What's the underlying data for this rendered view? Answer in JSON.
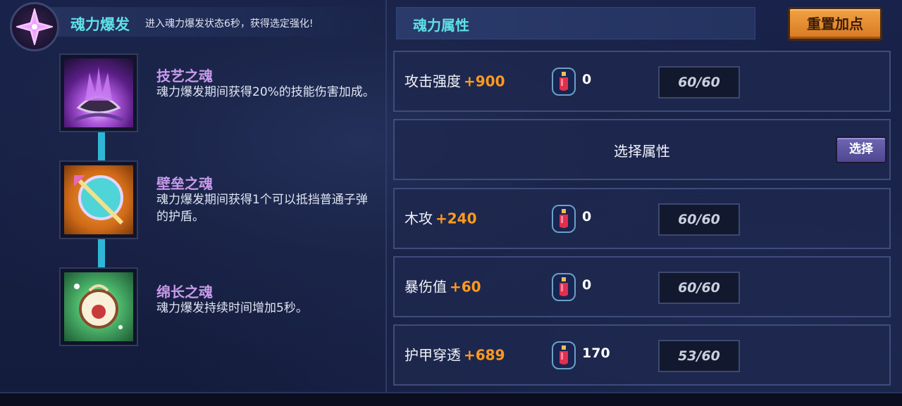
{
  "header": {
    "title": "魂力爆发",
    "description": "进入魂力爆发状态6秒，获得选定强化!",
    "icon": "soul-burst-icon"
  },
  "souls": [
    {
      "name": "技艺之魂",
      "description": "魂力爆发期间获得20%的技能伤害加成。",
      "icon": "skill-soul-icon"
    },
    {
      "name": "壁垒之魂",
      "description": "魂力爆发期间获得1个可以抵挡普通子弹的护盾。",
      "icon": "barrier-soul-icon"
    },
    {
      "name": "绵长之魂",
      "description": "魂力爆发持续时间增加5秒。",
      "icon": "endurance-soul-icon"
    }
  ],
  "attributes_panel": {
    "title": "魂力属性",
    "reset_label": "重置加点",
    "rows": [
      {
        "label": "攻击强度",
        "bonus": "+900",
        "potion_count": "0",
        "level": "60/60"
      },
      {
        "select_title": "选择属性",
        "select_label": "选择"
      },
      {
        "label": "木攻",
        "bonus": "+240",
        "potion_count": "0",
        "level": "60/60"
      },
      {
        "label": "暴伤值",
        "bonus": "+60",
        "potion_count": "0",
        "level": "60/60"
      },
      {
        "label": "护甲穿透",
        "bonus": "+689",
        "potion_count": "170",
        "level": "53/60"
      }
    ]
  },
  "colors": {
    "accent_cyan": "#5ee0e6",
    "soul_name_purple": "#c79ae9",
    "bonus_orange": "#ff9a1e",
    "reset_button": "#e58a2e",
    "select_button": "#5e56a2"
  }
}
